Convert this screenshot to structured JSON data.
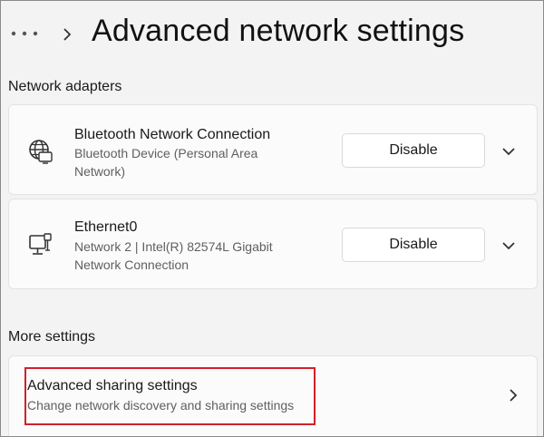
{
  "header": {
    "title": "Advanced network settings",
    "more_icon": "more-dots-icon",
    "breadcrumb_icon": "chevron-right-icon"
  },
  "network_adapters": {
    "heading": "Network adapters",
    "items": [
      {
        "name": "Bluetooth Network Connection",
        "description": "Bluetooth Device (Personal Area Network)",
        "action_label": "Disable",
        "icon": "globe-icon"
      },
      {
        "name": "Ethernet0",
        "description": "Network 2 | Intel(R) 82574L Gigabit Network Connection",
        "action_label": "Disable",
        "icon": "ethernet-icon"
      }
    ]
  },
  "more_settings": {
    "heading": "More settings",
    "items": [
      {
        "title": "Advanced sharing settings",
        "description": "Change network discovery and sharing settings",
        "highlighted": true,
        "highlight_color": "#d0202a"
      }
    ]
  },
  "colors": {
    "background": "#f3f3f3",
    "card": "#fbfbfb",
    "secondary_text": "#5f5f5f",
    "highlight": "#d0202a"
  }
}
